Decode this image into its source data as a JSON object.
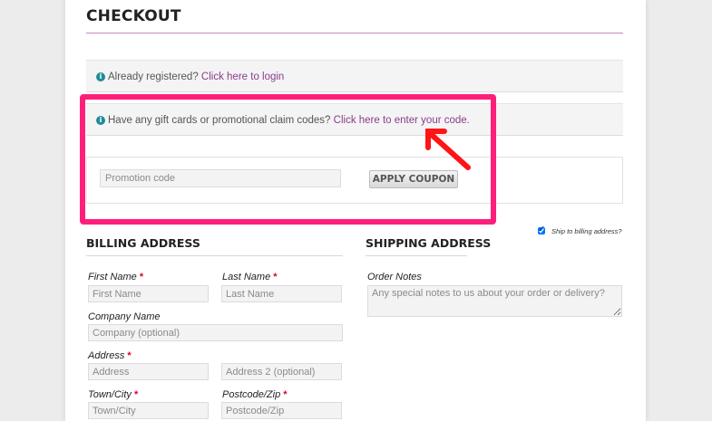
{
  "checkout": {
    "title": "CHECKOUT"
  },
  "login_notice": {
    "text": "Already registered? ",
    "link": "Click here to login"
  },
  "coupon_notice": {
    "text": "Have any gift cards or promotional claim codes? ",
    "link": "Click here to enter your code."
  },
  "coupon": {
    "placeholder": "Promotion code",
    "button": "APPLY COUPON"
  },
  "shipping_toggle": {
    "label": "Ship to billing address?",
    "checked": true
  },
  "billing": {
    "title": "BILLING ADDRESS",
    "first_name": {
      "label": "First Name",
      "placeholder": "First Name"
    },
    "last_name": {
      "label": "Last Name",
      "placeholder": "Last Name"
    },
    "company": {
      "label": "Company Name",
      "placeholder": "Company (optional)"
    },
    "address": {
      "label": "Address",
      "placeholder": "Address",
      "placeholder2": "Address 2 (optional)"
    },
    "city": {
      "label": "Town/City",
      "placeholder": "Town/City"
    },
    "postcode": {
      "label": "Postcode/Zip",
      "placeholder": "Postcode/Zip"
    }
  },
  "shipping": {
    "title": "SHIPPING ADDRESS",
    "notes_label": "Order Notes",
    "notes_placeholder": "Any special notes to us about your order or delivery?"
  },
  "icons": {
    "info": "info-icon",
    "annotation": "red-arrow"
  },
  "colors": {
    "link": "#8a3d8a",
    "highlight": "#ff1f7a",
    "info_icon": "#1f8c98",
    "required": "#e0002a"
  }
}
